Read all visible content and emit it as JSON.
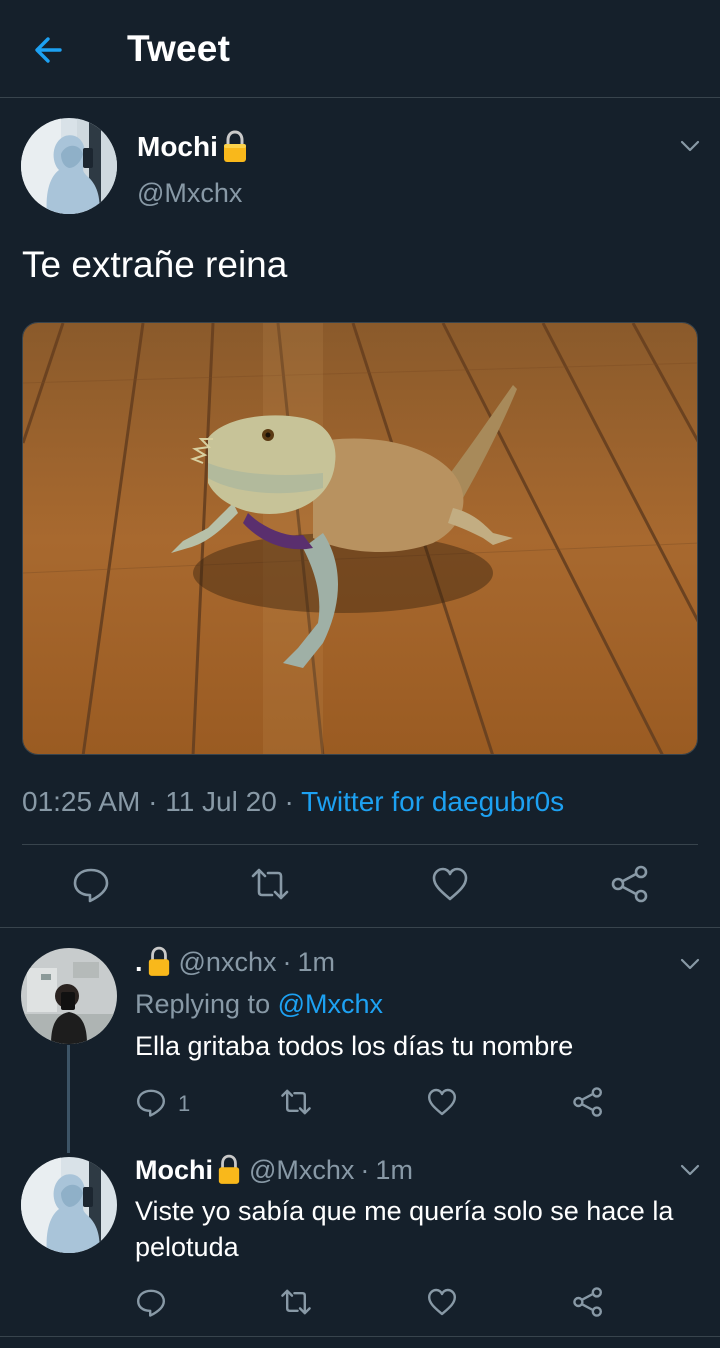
{
  "header": {
    "title": "Tweet",
    "back_icon": "arrow-left-icon",
    "accent": "#1da1f2"
  },
  "tweet": {
    "name": "Mochi",
    "handle": "@Mxchx",
    "text": "Te extrañe reina",
    "time": "01:25 AM",
    "date": "11 Jul 20",
    "sep": "·",
    "source": "Twitter for daegubr0s",
    "photo_icon": "bearded-dragon-photo"
  },
  "actions": [
    "reply-icon",
    "retweet-icon",
    "like-icon",
    "share-icon"
  ],
  "replies": [
    {
      "name": ".",
      "handle": "@nxchx",
      "sep": "·",
      "age": "1m",
      "replying_label": "Replying to",
      "replying_to": "@Mxchx",
      "text": "Ella gritaba todos los días tu nombre",
      "reply_count": "1"
    },
    {
      "name": "Mochi",
      "handle": "@Mxchx",
      "sep": "·",
      "age": "1m",
      "text_line1": "Viste yo sabía que me quería solo se hace la",
      "text_line2": "pelotuda"
    }
  ],
  "colors": {
    "background": "#15202b",
    "secondary_text": "#8899a6",
    "divider": "#38444d",
    "link": "#1da1f2"
  }
}
